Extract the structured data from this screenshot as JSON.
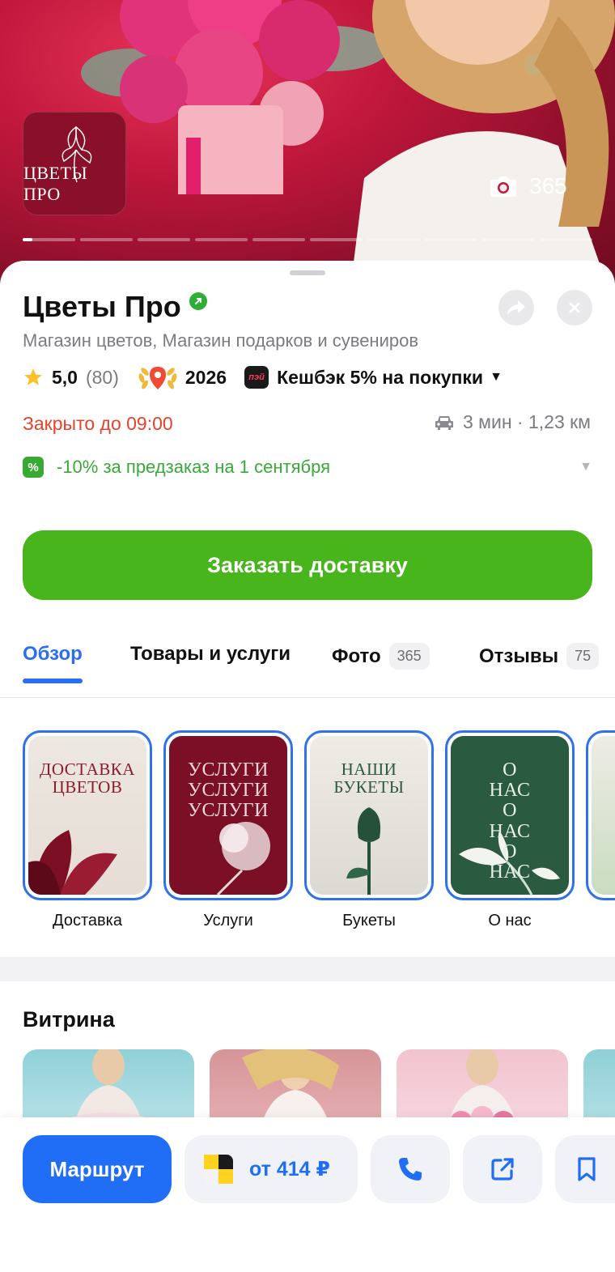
{
  "hero": {
    "logo_text": "ЦВЕТЫ ПРО",
    "photo_count": "365",
    "segments": 10,
    "active_segment_progress": 0.18
  },
  "place": {
    "name": "Цветы Про",
    "category": "Магазин цветов, Магазин подарков и сувениров",
    "rating": "5,0",
    "rating_count": "(80)",
    "award_year": "2026",
    "cashback_badge": "пэй",
    "cashback": "Кешбэк 5% на покупки",
    "hours": "Закрыто до 09:00",
    "route_info": "3 мин · 1,23 км",
    "promo_badge": "%",
    "promo": "-10% за предзаказ на 1 сентября",
    "order_button": "Заказать доставку"
  },
  "tabs": [
    {
      "label": "Обзор",
      "active": true
    },
    {
      "label": "Товары и услуги"
    },
    {
      "label": "Фото",
      "badge": "365"
    },
    {
      "label": "Отзывы",
      "badge": "75"
    }
  ],
  "stories": [
    {
      "caption": "ДОСТАВКА ЦВЕТОВ",
      "label": "Доставка"
    },
    {
      "caption": "УСЛУГИ УСЛУГИ УСЛУГИ",
      "label": "Услуги"
    },
    {
      "caption": "НАШИ БУКЕТЫ",
      "label": "Букеты"
    },
    {
      "caption": "О НАС О НАС О НАС",
      "label": "О нас"
    }
  ],
  "showcase": {
    "title": "Витрина"
  },
  "bottom_bar": {
    "route_label": "Маршрут",
    "taxi_price": "от 414 ₽"
  },
  "colors": {
    "accent_blue": "#2b6ef2",
    "order_green": "#47b51b",
    "closed_red": "#e8412c",
    "promo_green": "#3aa93a"
  }
}
